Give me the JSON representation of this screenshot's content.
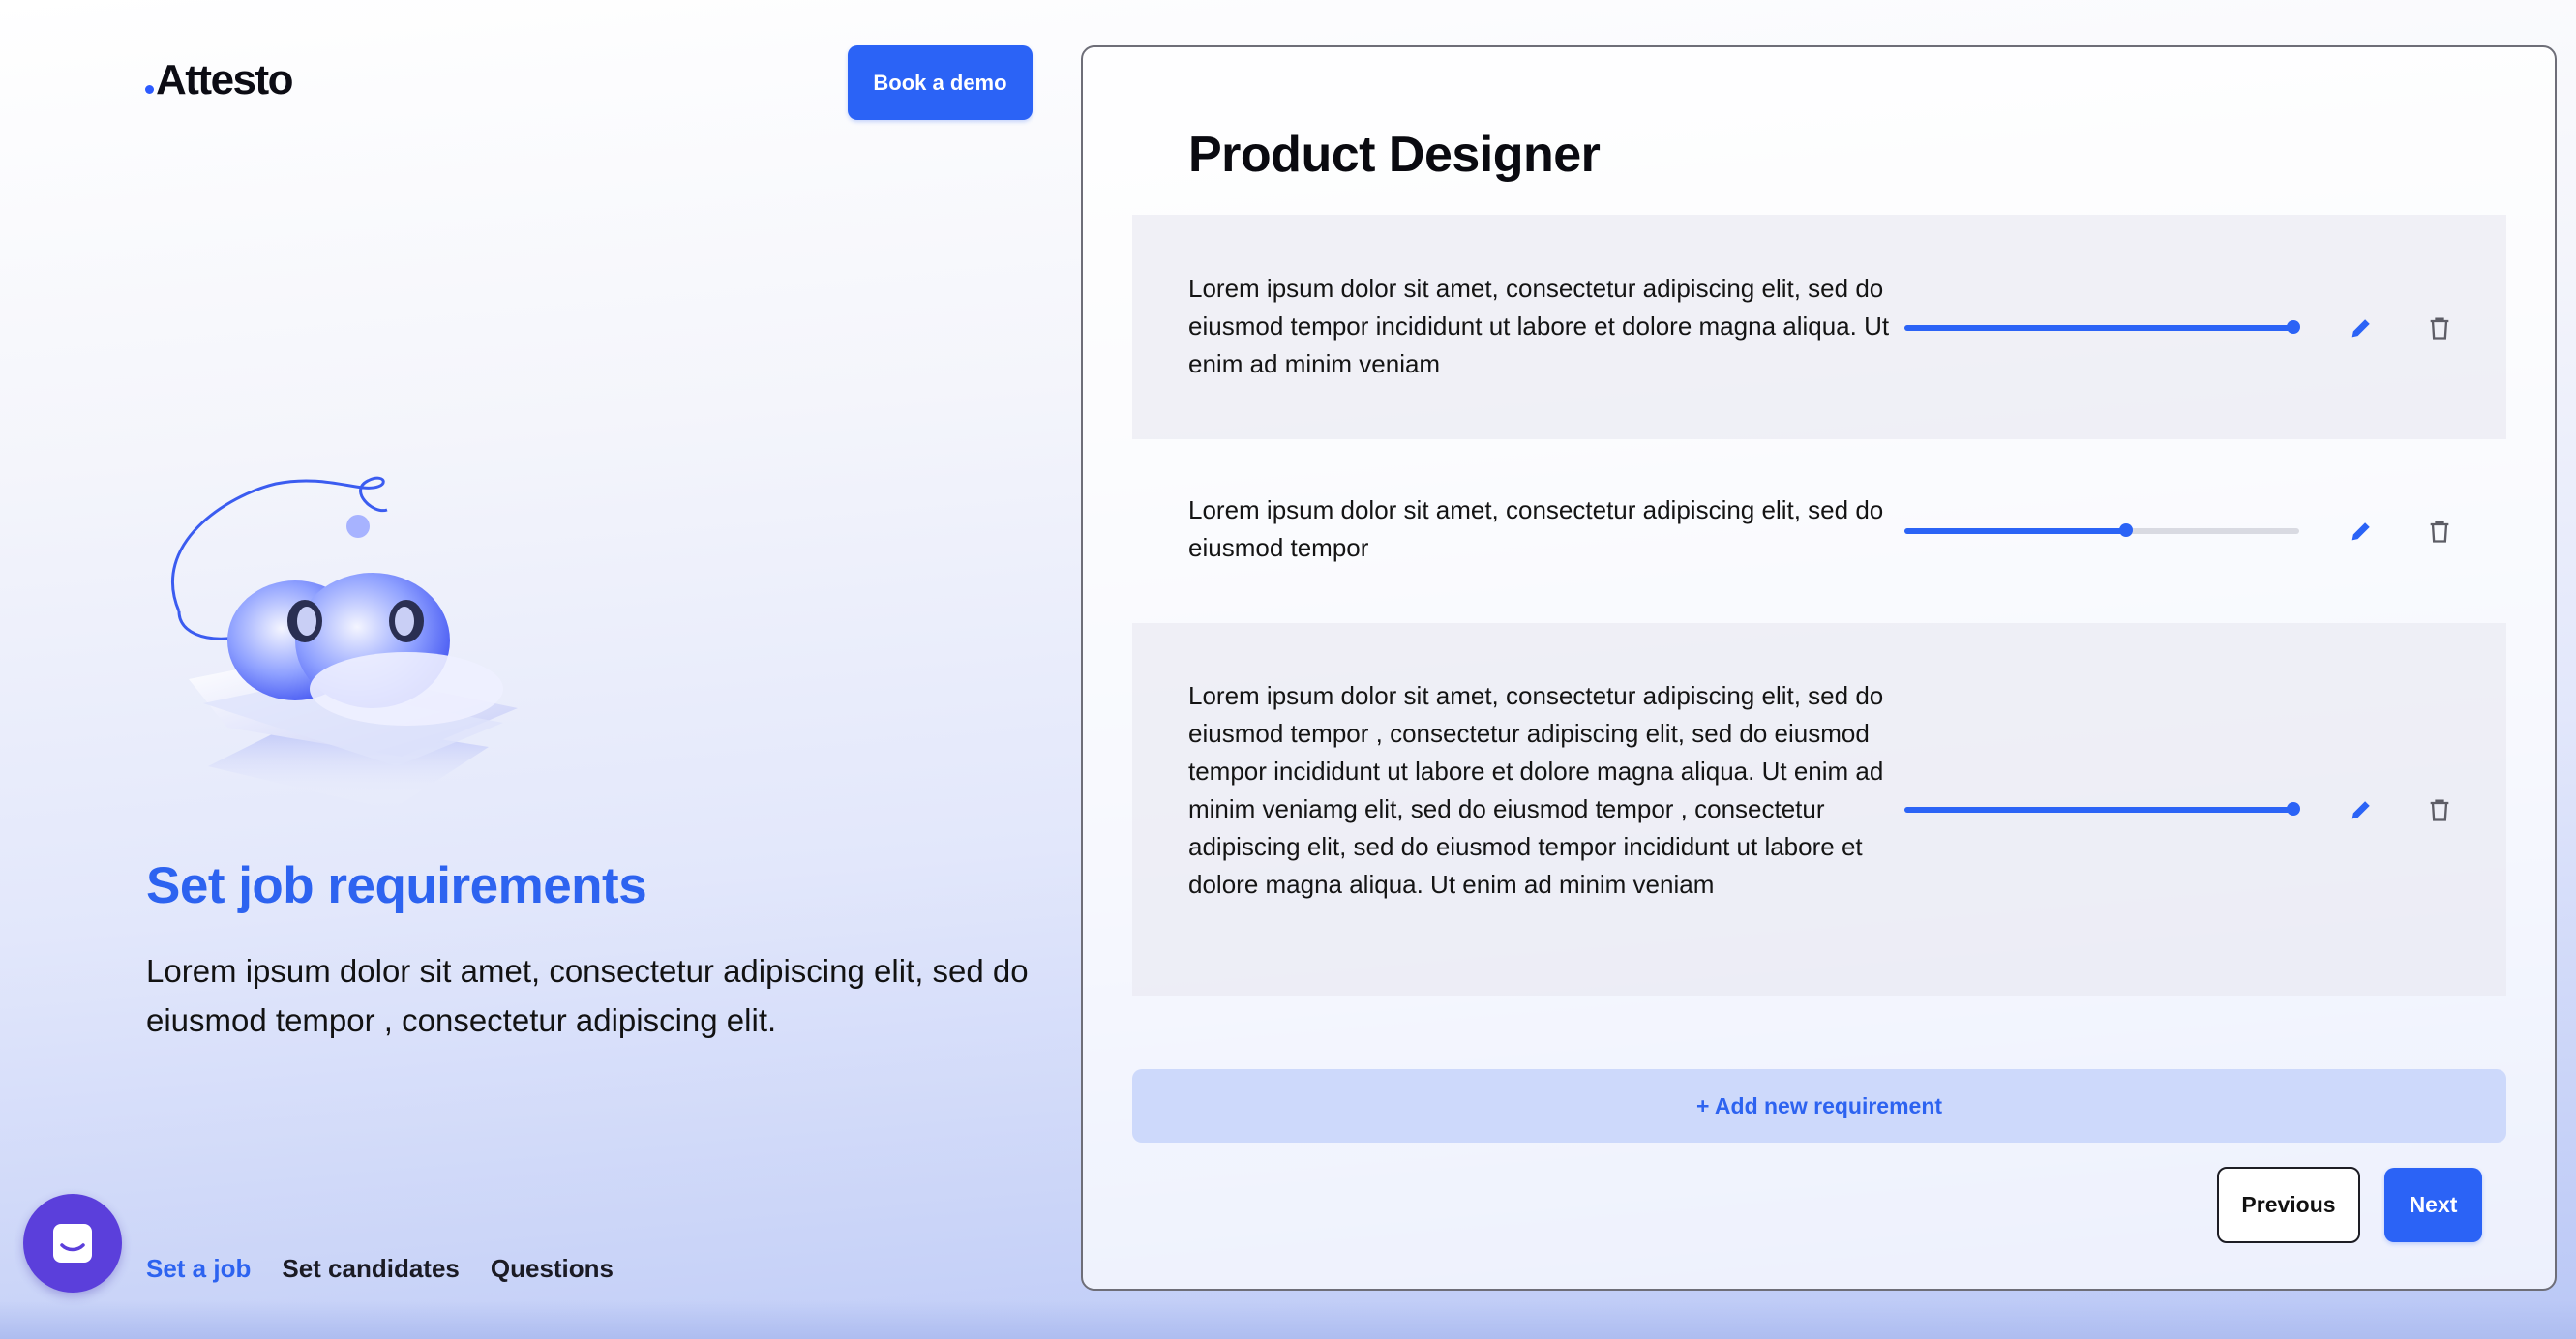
{
  "brand": {
    "logo_text": "Attesto",
    "accent": "#2b63f6"
  },
  "header": {
    "demo_button": "Book a demo"
  },
  "hero": {
    "title": "Set job requirements",
    "description": "Lorem ipsum dolor sit amet, consectetur adipiscing elit, sed do eiusmod tempor , consectetur adipiscing elit."
  },
  "bottom_nav": {
    "items": [
      "Set a job",
      "Set candidates",
      "Questions"
    ],
    "active": "Set a job"
  },
  "panel": {
    "title": "Product Designer",
    "requirements": [
      {
        "text": "Lorem ipsum dolor sit amet, consectetur adipiscing elit, sed do eiusmod tempor incididunt ut labore et dolore magna aliqua. Ut enim ad minim veniam",
        "level": 1.0
      },
      {
        "text": "Lorem ipsum dolor sit amet, consectetur adipiscing elit, sed do eiusmod tempor",
        "level": 0.57
      },
      {
        "text": "Lorem ipsum dolor sit amet, consectetur adipiscing elit, sed do eiusmod tempor , consectetur adipiscing elit, sed do eiusmod tempor incididunt ut labore et dolore magna aliqua. Ut enim ad minim veniamg elit, sed do eiusmod tempor , consectetur adipiscing elit, sed do eiusmod tempor incididunt ut labore et dolore magna aliqua. Ut enim ad minim veniam",
        "level": 1.0
      }
    ],
    "add_button": "+ Add new requirement",
    "previous_button": "Previous",
    "next_button": "Next"
  },
  "icons": {
    "edit": "pencil-icon",
    "delete": "trash-icon",
    "chat": "chat-icon"
  }
}
